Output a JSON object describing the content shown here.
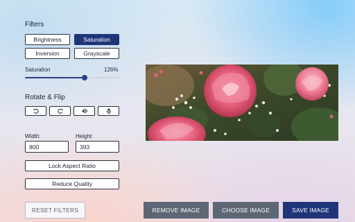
{
  "filters": {
    "title": "Filters",
    "buttons": [
      {
        "label": "Brightness",
        "active": false
      },
      {
        "label": "Saturation",
        "active": true
      },
      {
        "label": "Inversion",
        "active": false
      },
      {
        "label": "Grayscale",
        "active": false
      }
    ]
  },
  "slider": {
    "name": "Saturation",
    "value_label": "126%",
    "fraction": 0.63
  },
  "rotate": {
    "title": "Rotate & Flip",
    "icons": [
      "rotate-left-icon",
      "rotate-right-icon",
      "flip-horizontal-icon",
      "flip-vertical-icon"
    ]
  },
  "dimensions": {
    "width_label": "Width:",
    "width_value": "800",
    "height_label": "Height:",
    "height_value": "393"
  },
  "options": {
    "lock_aspect": "Lock Aspect Ratio",
    "reduce_quality": "Reduce Quality"
  },
  "actions": {
    "reset": "RESET FILTERS",
    "remove": "REMOVE IMAGE",
    "choose": "CHOOSE IMAGE",
    "save": "SAVE IMAGE"
  },
  "colors": {
    "accent": "#1f3577",
    "secondary_button": "#5d6675"
  }
}
